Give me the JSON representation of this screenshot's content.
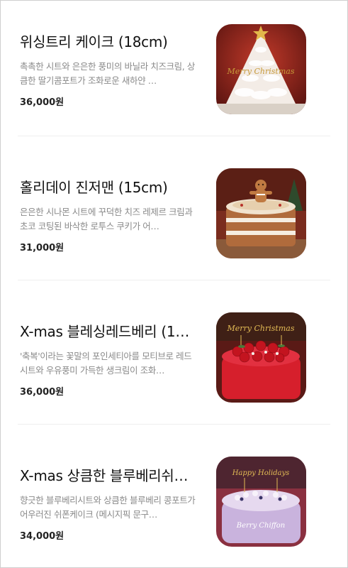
{
  "products": [
    {
      "name": "위싱트리 케이크 (18cm)",
      "description": "촉촉한 시트와 은은한 풍미의 바닐라 치즈크림, 상큼한 딸기콤포트가 조화로운 새하얀 …",
      "price": "36,000원",
      "image_icon": "christmas-tree-cake-image",
      "image_text": "Merry Christmas"
    },
    {
      "name": "홀리데이 진저맨 (15cm)",
      "description": "은은한 시나몬 시트에 꾸덕한 치즈 레제르 크림과 초코 코팅된 바삭한 로투스 쿠키가 어…",
      "price": "31,000원",
      "image_icon": "gingerbread-cake-image"
    },
    {
      "name": "X-mas 블레싱레드베리 (15…",
      "description": "'축복'이라는 꽃말의 포인세티아를 모티브로 레드시트와 우유풍미 가득한 생크림이 조화…",
      "price": "36,000원",
      "image_icon": "red-berry-cake-image",
      "image_text": "Merry Christmas"
    },
    {
      "name": "X-mas 상큼한 블루베리쉬…",
      "description": "향긋한 블루베리시트와 상큼한 블루베리 콩포트가 어우러진 쉬폰케이크 (메시지픽 문구…",
      "price": "34,000원",
      "image_icon": "blueberry-chiffon-cake-image",
      "image_text": "Happy Holidays",
      "image_text_2": "Berry Chiffon"
    }
  ]
}
